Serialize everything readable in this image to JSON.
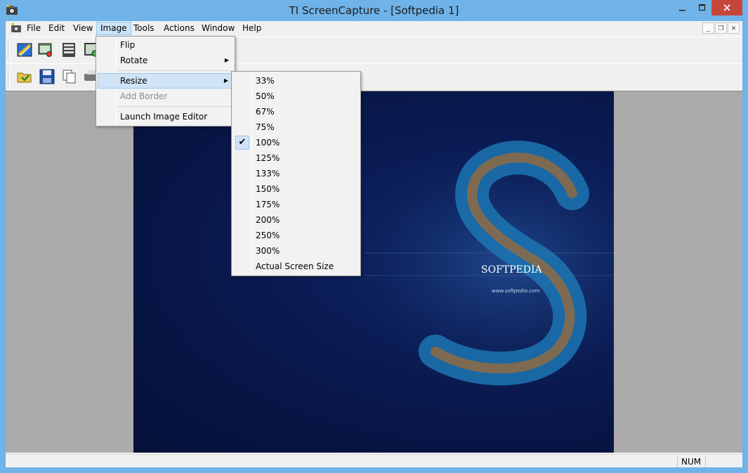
{
  "window": {
    "title": "TI ScreenCapture - [Softpedia 1]",
    "minimize_icon": "minimize-icon",
    "maximize_icon": "maximize-icon",
    "close_icon": "close-icon",
    "close_color": "#c7463b"
  },
  "menubar": {
    "items": [
      "File",
      "Edit",
      "View",
      "Image",
      "Tools",
      "Actions",
      "Window",
      "Help"
    ],
    "active": "Image"
  },
  "image_menu": {
    "items": [
      {
        "label": "Flip",
        "enabled": true,
        "submenu": false
      },
      {
        "label": "Rotate",
        "enabled": true,
        "submenu": true
      },
      {
        "label": "Resize",
        "enabled": true,
        "submenu": true,
        "highlighted": true
      },
      {
        "label": "Add Border",
        "enabled": false,
        "submenu": false
      },
      {
        "label": "Launch Image Editor",
        "enabled": true,
        "submenu": false
      }
    ]
  },
  "resize_menu": {
    "items": [
      "33%",
      "50%",
      "67%",
      "75%",
      "100%",
      "125%",
      "133%",
      "150%",
      "175%",
      "200%",
      "250%",
      "300%",
      "Actual Screen Size"
    ],
    "checked": "100%"
  },
  "image_overlay": {
    "brand": "SOFTPEDIA",
    "url": "www.softpedia.com"
  },
  "statusbar": {
    "num": "NUM"
  },
  "colors": {
    "titlebar": "#6fb3e8",
    "workspace": "#ababab",
    "menu_highlight": "#d1e4f6"
  }
}
